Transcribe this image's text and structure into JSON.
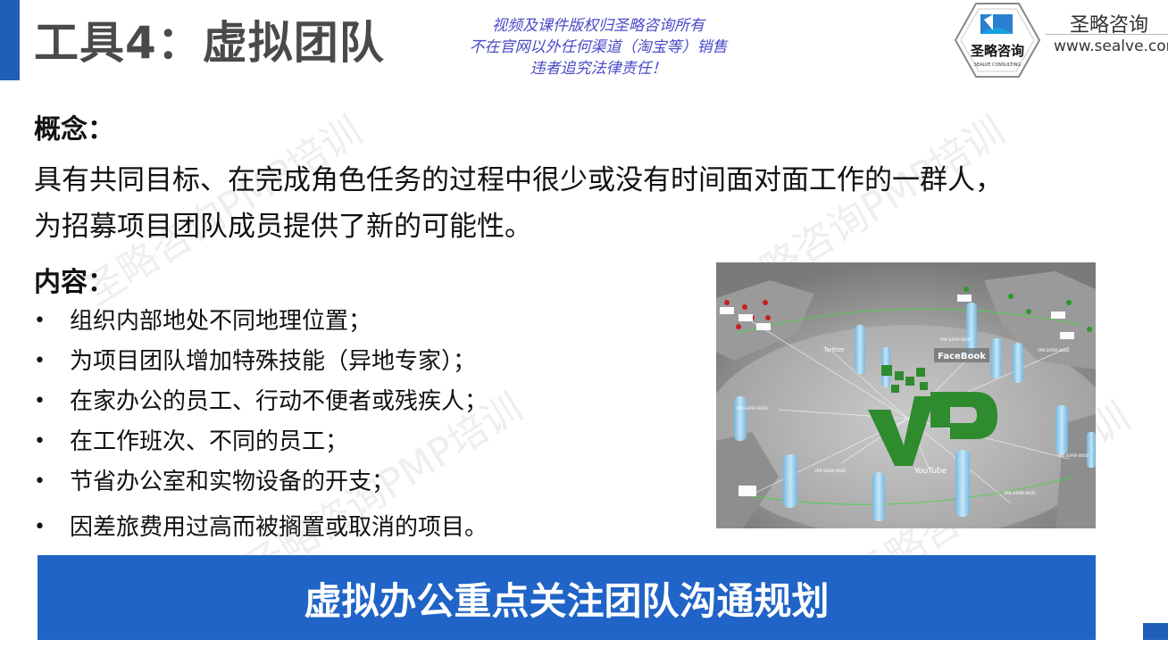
{
  "slide": {
    "title": "工具4：虚拟团队",
    "copyright_lines": [
      "视频及课件版权归圣略咨询所有",
      "不在官网以外任何渠道（淘宝等）销售",
      "违者追究法律责任！"
    ],
    "brand": {
      "logo_text": "圣略咨询",
      "logo_subtext": "SEALVE CONSULTING",
      "name": "圣略咨询",
      "url": "www.sealve.com"
    },
    "concept": {
      "heading": "概念：",
      "lines": [
        "具有共同目标、在完成角色任务的过程中很少或没有时间面对面工作的一群人，",
        "为招募项目团队成员提供了新的可能性。"
      ]
    },
    "content": {
      "heading": "内容：",
      "bullets": [
        "组织内部地处不同地理位置；",
        "为项目团队增加特殊技能（异地专家）；",
        "在家办公的员工、行动不便者或残疾人；",
        "在工作班次、不同的员工；",
        "节省办公室和实物设备的开支；",
        "因差旅费用过高而被搁置或取消的项目。"
      ]
    },
    "image_labels": {
      "facebook": "FaceBook",
      "twitter": "Twitter",
      "youtube": "YouTube",
      "vpn_nodes": [
        "VPN SUPER NODE",
        "VPN SUPER NODE",
        "VPN SUPER NODE",
        "VPN SUPER NODE",
        "VPN SUPER NODE",
        "VPN SUPER NODE"
      ],
      "logo_letters": "VP"
    },
    "banner": "虚拟办公重点关注团队沟通规划",
    "watermark": "圣略咨询PMP培训",
    "colors": {
      "accent": "#1f64c6",
      "title_gray": "#4a4a4a",
      "copyright_blue": "#4a4ac8",
      "logo_green": "#2e8b2e"
    }
  }
}
